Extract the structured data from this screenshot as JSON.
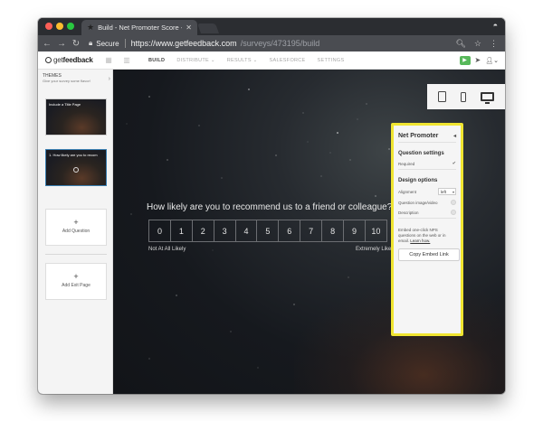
{
  "browser": {
    "tab_title": "Build - Net Promoter Score -",
    "secure_label": "Secure",
    "url_host": "https://www.getfeedback.com",
    "url_path": "/surveys/473195/build"
  },
  "app": {
    "logo_prefix": "get",
    "logo_suffix": "feedback",
    "nav": [
      "BUILD",
      "DISTRIBUTE ⌄",
      "RESULTS ⌄",
      "SALESFORCE",
      "SETTINGS"
    ]
  },
  "sidebar": {
    "themes_title": "THEMES",
    "themes_subtitle": "Give your survey some flavor!",
    "pages": [
      {
        "label": "Include a Title Page"
      },
      {
        "label": "1. How likely are you to recom"
      }
    ],
    "add_question": "Add Question",
    "add_exit": "Add Exit Page",
    "plus": "+"
  },
  "survey": {
    "question": "How likely are you to recommend us to a friend or colleague?",
    "scale": [
      "0",
      "1",
      "2",
      "3",
      "4",
      "5",
      "6",
      "7",
      "8",
      "9",
      "10"
    ],
    "low_label": "Not At All Likely",
    "high_label": "Extremely Likely"
  },
  "panel": {
    "title": "Net Promoter",
    "question_settings": "Question settings",
    "required_label": "Required",
    "design_options": "Design options",
    "alignment_label": "Alignment",
    "alignment_value": "left",
    "image_label": "Question image/video",
    "description_label": "Description",
    "embed_text": "Embed one-click NPS questions on the web or in email.",
    "learn_more": "Learn how.",
    "embed_button": "Copy Embed Link"
  },
  "colors": {
    "highlight": "#f0e531",
    "preview_green": "#57b85a",
    "selected_border": "#3a7fb1"
  }
}
